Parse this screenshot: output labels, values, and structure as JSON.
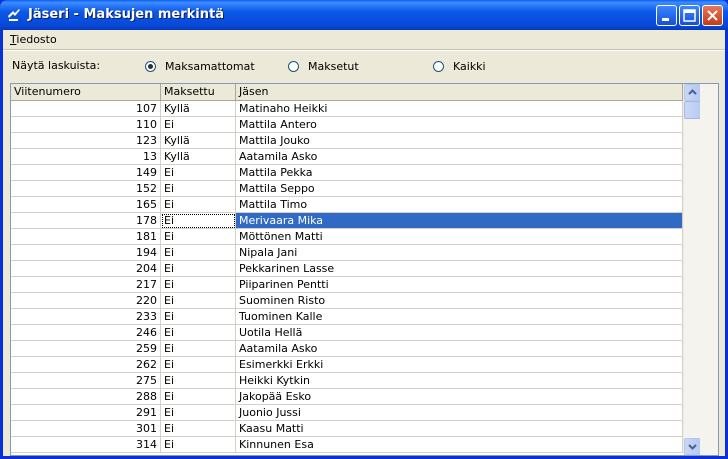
{
  "window": {
    "title": "Jäseri - Maksujen merkintä"
  },
  "menu": {
    "file_label_underline": "T",
    "file_label_rest": "iedosto"
  },
  "filter": {
    "label": "Näytä laskuista:",
    "options": [
      "Maksamattomat",
      "Maksetut",
      "Kaikki"
    ],
    "selected_index": 0
  },
  "table": {
    "columns": [
      "Viitenumero",
      "Maksettu",
      "Jäsen"
    ],
    "selected_row": 7,
    "rows": [
      [
        "107",
        "Kyllä",
        "Matinaho Heikki"
      ],
      [
        "110",
        "Ei",
        "Mattila Antero"
      ],
      [
        "123",
        "Kyllä",
        "Mattila Jouko"
      ],
      [
        "13",
        "Kyllä",
        "Aatamila Asko"
      ],
      [
        "149",
        "Ei",
        "Mattila Pekka"
      ],
      [
        "152",
        "Ei",
        "Mattila Seppo"
      ],
      [
        "165",
        "Ei",
        "Mattila Timo"
      ],
      [
        "178",
        "Ei",
        "Merivaara Mika"
      ],
      [
        "181",
        "Ei",
        "Möttönen Matti"
      ],
      [
        "194",
        "Ei",
        "Nipala Jani"
      ],
      [
        "204",
        "Ei",
        "Pekkarinen Lasse"
      ],
      [
        "217",
        "Ei",
        "Piiparinen Pentti"
      ],
      [
        "220",
        "Ei",
        "Suominen Risto"
      ],
      [
        "233",
        "Ei",
        "Tuominen Kalle"
      ],
      [
        "246",
        "Ei",
        "Uotila Hellä"
      ],
      [
        "259",
        "Ei",
        "Aatamila Asko"
      ],
      [
        "262",
        "Ei",
        "Esimerkki Erkki"
      ],
      [
        "275",
        "Ei",
        "Heikki Kytkin"
      ],
      [
        "288",
        "Ei",
        "Jakopää Esko"
      ],
      [
        "291",
        "Ei",
        "Juonio Jussi"
      ],
      [
        "301",
        "Ei",
        "Kaasu Matti"
      ],
      [
        "314",
        "Ei",
        "Kinnunen Esa"
      ]
    ]
  }
}
